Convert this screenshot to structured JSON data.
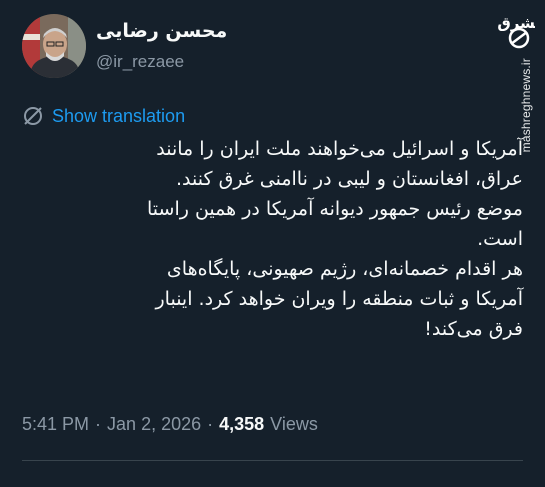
{
  "author": {
    "display_name": "محسن رضایی",
    "handle": "@ir_rezaee"
  },
  "watermark": {
    "logo_icon": "mashregh-logo-icon",
    "site": "mashreghnews.ir"
  },
  "translate": {
    "label": "Show translation",
    "icon": "globe-slash-icon"
  },
  "tweet": {
    "lines": [
      "آمریکا و اسرائیل می‌خواهند ملت ایران را مانند",
      "عراق، افغانستان و لیبی در ناامنی غرق کنند.",
      "موضع رئیس جمهور دیوانه آمریکا در همین راستا",
      "است.",
      "هر اقدام خصمانه‌ای، رژیم صهیونی، پایگاه‌های",
      "آمریکا و ثبات منطقه را ویران خواهد کرد. اینبار",
      "فرق می‌کند!"
    ]
  },
  "meta": {
    "time": "5:41 PM",
    "sep1": "·",
    "date": "Jan 2, 2026",
    "sep2": "·",
    "views_count": "4,358",
    "views_label": "Views"
  },
  "colors": {
    "background": "#15202b",
    "link": "#1d9bf0",
    "muted": "#8b98a5",
    "text": "#f7f9f9"
  }
}
